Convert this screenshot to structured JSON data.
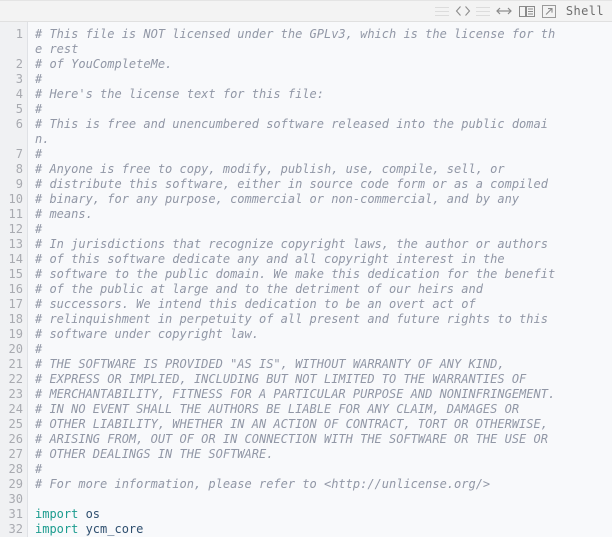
{
  "toolbar": {
    "icons": [
      {
        "name": "menu-lines-icon",
        "kind": "lines"
      },
      {
        "name": "code-brackets-icon",
        "kind": "brackets"
      },
      {
        "name": "menu-lines-icon",
        "kind": "lines"
      },
      {
        "name": "horizontal-resize-icon",
        "kind": "arrows"
      },
      {
        "name": "split-panes-icon",
        "kind": "panes"
      },
      {
        "name": "popout-window-icon",
        "kind": "popout"
      }
    ],
    "label": "Shell"
  },
  "editor": {
    "gutter": [
      "1",
      "",
      "2",
      "3",
      "4",
      "5",
      "6",
      "",
      "7",
      "8",
      "9",
      "10",
      "11",
      "12",
      "13",
      "14",
      "15",
      "16",
      "17",
      "18",
      "19",
      "20",
      "21",
      "22",
      "23",
      "24",
      "25",
      "26",
      "27",
      "28",
      "29",
      "30",
      "31",
      "32"
    ],
    "lines": [
      {
        "n": "1",
        "type": "comment",
        "text": "# This file is NOT licensed under the GPLv3, which is the license for th"
      },
      {
        "n": "",
        "type": "comment",
        "text": "e rest"
      },
      {
        "n": "2",
        "type": "comment",
        "text": "# of YouCompleteMe."
      },
      {
        "n": "3",
        "type": "comment",
        "text": "#"
      },
      {
        "n": "4",
        "type": "comment",
        "text": "# Here's the license text for this file:"
      },
      {
        "n": "5",
        "type": "comment",
        "text": "#"
      },
      {
        "n": "6",
        "type": "comment",
        "text": "# This is free and unencumbered software released into the public domai"
      },
      {
        "n": "",
        "type": "comment",
        "text": "n."
      },
      {
        "n": "7",
        "type": "comment",
        "text": "#"
      },
      {
        "n": "8",
        "type": "comment",
        "text": "# Anyone is free to copy, modify, publish, use, compile, sell, or"
      },
      {
        "n": "9",
        "type": "comment",
        "text": "# distribute this software, either in source code form or as a compiled"
      },
      {
        "n": "10",
        "type": "comment",
        "text": "# binary, for any purpose, commercial or non-commercial, and by any"
      },
      {
        "n": "11",
        "type": "comment",
        "text": "# means."
      },
      {
        "n": "12",
        "type": "comment",
        "text": "#"
      },
      {
        "n": "13",
        "type": "comment",
        "text": "# In jurisdictions that recognize copyright laws, the author or authors"
      },
      {
        "n": "14",
        "type": "comment",
        "text": "# of this software dedicate any and all copyright interest in the"
      },
      {
        "n": "15",
        "type": "comment",
        "text": "# software to the public domain. We make this dedication for the benefit"
      },
      {
        "n": "16",
        "type": "comment",
        "text": "# of the public at large and to the detriment of our heirs and"
      },
      {
        "n": "17",
        "type": "comment",
        "text": "# successors. We intend this dedication to be an overt act of"
      },
      {
        "n": "18",
        "type": "comment",
        "text": "# relinquishment in perpetuity of all present and future rights to this"
      },
      {
        "n": "19",
        "type": "comment",
        "text": "# software under copyright law."
      },
      {
        "n": "20",
        "type": "comment",
        "text": "#"
      },
      {
        "n": "21",
        "type": "comment",
        "text": "# THE SOFTWARE IS PROVIDED \"AS IS\", WITHOUT WARRANTY OF ANY KIND,"
      },
      {
        "n": "22",
        "type": "comment",
        "text": "# EXPRESS OR IMPLIED, INCLUDING BUT NOT LIMITED TO THE WARRANTIES OF"
      },
      {
        "n": "23",
        "type": "comment",
        "text": "# MERCHANTABILITY, FITNESS FOR A PARTICULAR PURPOSE AND NONINFRINGEMENT."
      },
      {
        "n": "24",
        "type": "comment",
        "text": "# IN NO EVENT SHALL THE AUTHORS BE LIABLE FOR ANY CLAIM, DAMAGES OR"
      },
      {
        "n": "25",
        "type": "comment",
        "text": "# OTHER LIABILITY, WHETHER IN AN ACTION OF CONTRACT, TORT OR OTHERWISE,"
      },
      {
        "n": "26",
        "type": "comment",
        "text": "# ARISING FROM, OUT OF OR IN CONNECTION WITH THE SOFTWARE OR THE USE OR"
      },
      {
        "n": "27",
        "type": "comment",
        "text": "# OTHER DEALINGS IN THE SOFTWARE."
      },
      {
        "n": "28",
        "type": "comment",
        "text": "#"
      },
      {
        "n": "29",
        "type": "comment",
        "text": "# For more information, please refer to <http://unlicense.org/>"
      },
      {
        "n": "30",
        "type": "blank",
        "text": ""
      },
      {
        "n": "31",
        "type": "import",
        "keyword": "import",
        "name": " os"
      },
      {
        "n": "32",
        "type": "import",
        "keyword": "import",
        "name": " ycm_core"
      }
    ]
  },
  "colors": {
    "comment": "#9197a6",
    "keyword": "#1c9c8f",
    "identifier": "#2f4f6f",
    "gutter_text": "#a8aab0",
    "gutter_bg": "#f0f1f3",
    "editor_bg": "#f8f9fb",
    "toolbar_bg": "#f3f3f3"
  }
}
